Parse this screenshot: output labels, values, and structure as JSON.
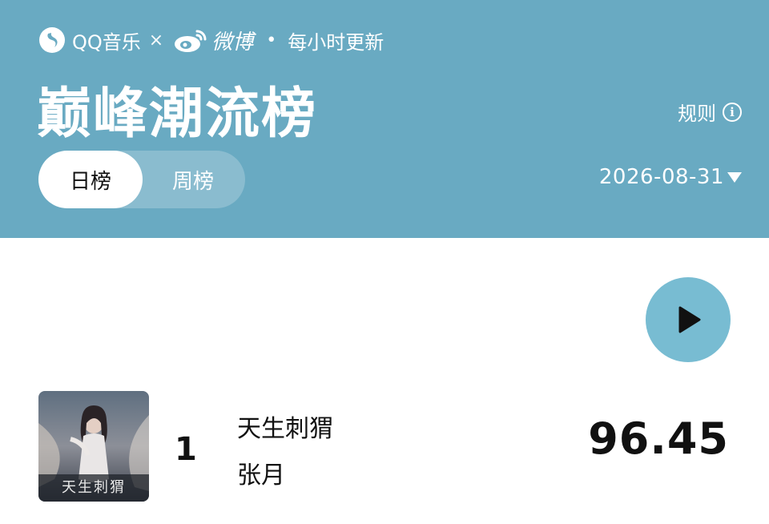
{
  "header": {
    "brand": {
      "qq_music": "QQ音乐",
      "separator": "×",
      "weibo": "微博",
      "dot": "•",
      "update_note": "每小时更新"
    },
    "title": "巅峰潮流榜",
    "rules_label": "规则",
    "rules_icon": "info-icon",
    "tabs": [
      {
        "label": "日榜",
        "active": true
      },
      {
        "label": "周榜",
        "active": false
      }
    ],
    "date": "2026-08-31",
    "background_color": "#69aac2"
  },
  "play_all": {
    "icon": "play-icon",
    "color": "#78bcd2"
  },
  "songs": [
    {
      "rank": "1",
      "title": "天生刺猬",
      "artist": "张月",
      "score": "96.45",
      "cover_text": "天生刺猬"
    }
  ]
}
